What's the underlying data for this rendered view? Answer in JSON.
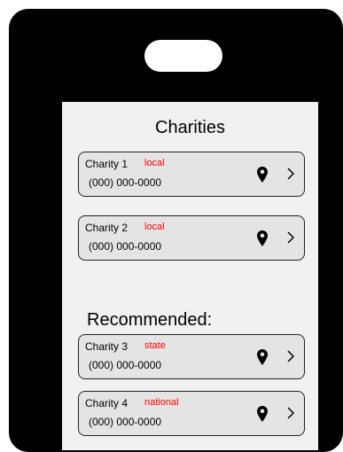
{
  "screen": {
    "title": "Charities",
    "recommended_label": "Recommended:"
  },
  "charities": [
    {
      "name": "Charity 1",
      "tag": "local",
      "phone": "(000) 000-0000"
    },
    {
      "name": "Charity 2",
      "tag": "local",
      "phone": "(000) 000-0000"
    }
  ],
  "recommended": [
    {
      "name": "Charity 3",
      "tag": "state",
      "phone": "(000) 000-0000"
    },
    {
      "name": "Charity 4",
      "tag": "national",
      "phone": "(000) 000-0000"
    }
  ],
  "icons": {
    "location": "map-pin-icon",
    "open": "chevron-right-icon"
  },
  "colors": {
    "tag": "#ff0000",
    "card_bg": "#e4e4e4",
    "device": "#000000"
  }
}
